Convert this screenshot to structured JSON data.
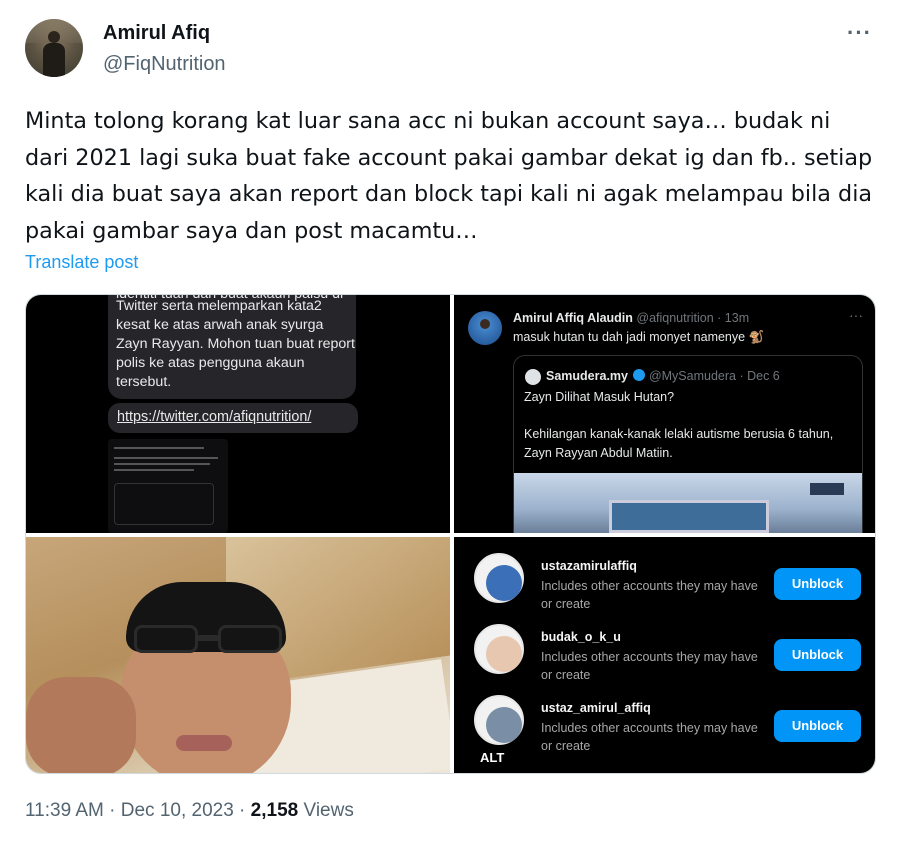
{
  "author": {
    "name": "Amirul Afiq",
    "handle": "@FiqNutrition"
  },
  "more_icon": "more-horizontal-icon",
  "tweet_text": "Minta tolong korang kat luar sana acc ni bukan account saya… budak ni dari 2021 lagi suka buat fake account pakai gambar dekat ig dan fb.. setiap kali dia buat saya akan report dan block tapi kali ni agak melampau bila dia pakai gambar saya dan post macamtu…",
  "translate_label": "Translate post",
  "media": {
    "image1": {
      "cut_text": "identiti tuan dan buat akaun palsu di",
      "message": "Twitter serta melemparkan kata2 kesat ke atas arwah anak syurga Zayn Rayyan. Mohon tuan buat report polis ke atas pengguna akaun tersebut.",
      "link": "https://twitter.com/afiqnutrition/"
    },
    "image2": {
      "user_name": "Amirul Affiq Alaudin",
      "user_handle": "@afiqnutrition · 13m",
      "text": "masuk hutan tu dah jadi monyet namenye 🐒",
      "quote_name": "Samudera.my",
      "quote_handle": "@MySamudera · Dec 6",
      "quote_text1": "Zayn Dilihat Masuk Hutan?",
      "quote_text2": "Kehilangan kanak-kanak lelaki autisme berusia 6 tahun, Zayn Rayyan Abdul Matiin."
    },
    "image4": {
      "rows": [
        {
          "username": "ustazamirulaffiq",
          "desc": "Includes other accounts they may have or create",
          "button": "Unblock"
        },
        {
          "username": "budak_o_k_u",
          "desc": "Includes other accounts they may have or create",
          "button": "Unblock"
        },
        {
          "username": "ustaz_amirul_affiq",
          "desc": "Includes other accounts they may have or create",
          "button": "Unblock"
        }
      ],
      "alt_badge": "ALT"
    }
  },
  "meta": {
    "time": "11:39 AM · Dec 10, 2023 · ",
    "views_count": "2,158",
    "views_label": " Views"
  }
}
